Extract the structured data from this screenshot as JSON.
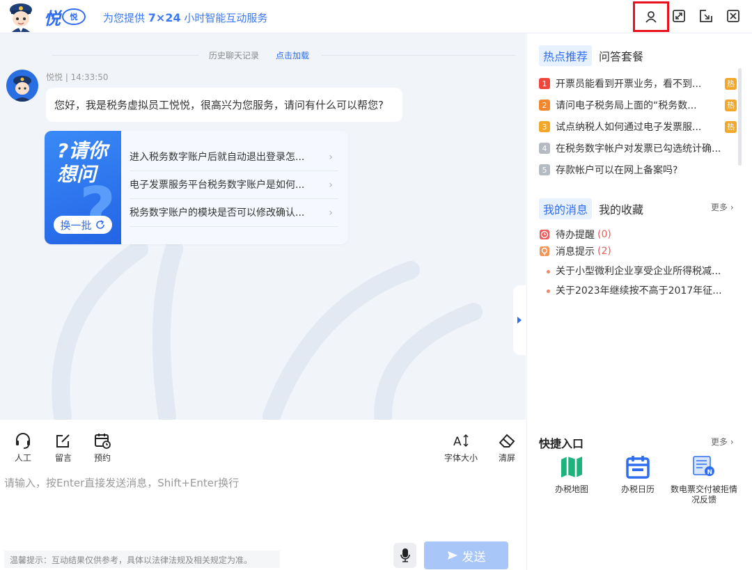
{
  "header": {
    "brand_char": "悦",
    "brand_badge": "悦",
    "slogan_prefix": "为您提供",
    "slogan_hours": "7×24",
    "slogan_suffix": "小时智能互动服务"
  },
  "chat": {
    "history_label": "历史聊天记录",
    "history_link": "点击加载",
    "sender": "悦悦 | 14:33:50",
    "greeting": "您好，我是税务虚拟员工悦悦，很高兴为您服务，请问有什么可以帮您?",
    "suggest_title": "?请你想问",
    "suggest_refresh": "换一批",
    "suggestions": [
      "进入税务数字账户后就自动退出登录怎...",
      "电子发票服务平台税务数字账户是如何...",
      "税务数字账户的模块是否可以修改确认..."
    ]
  },
  "toolbar": {
    "human": "人工",
    "message": "留言",
    "appointment": "预约",
    "font_size": "字体大小",
    "clear": "清屏"
  },
  "input": {
    "placeholder": "请输入，按Enter直接发送消息，Shift+Enter换行",
    "tip": "温馨提示：互动结果仅供参考，具体以法律法规及相关规定为准。",
    "send": "发送"
  },
  "right": {
    "tabs1": [
      "热点推荐",
      "问答套餐"
    ],
    "hot": [
      {
        "n": "1",
        "text": "开票员能看到开票业务，看不到...",
        "tag": "热",
        "color": "#f0463c"
      },
      {
        "n": "2",
        "text": "请问电子税务局上面的“税务数...",
        "tag": "热",
        "color": "#f2872e"
      },
      {
        "n": "3",
        "text": "试点纳税人如何通过电子发票服...",
        "tag": "热",
        "color": "#f3a728"
      },
      {
        "n": "4",
        "text": "在税务数字帐户对发票已勾选统计确...",
        "tag": "",
        "color": "#b6bac2"
      },
      {
        "n": "5",
        "text": "存款帐户可以在网上备案吗?",
        "tag": "",
        "color": "#b6bac2"
      }
    ],
    "tabs2": [
      "我的消息",
      "我的收藏"
    ],
    "more": "更多",
    "todo_label": "待办提醒",
    "todo_count": "(0)",
    "notice_label": "消息提示",
    "notice_count": "(2)",
    "announcements": [
      "关于小型微利企业享受企业所得税减...",
      "关于2023年继续按不高于2017年征..."
    ],
    "quick_title": "快捷入口",
    "quick_more": "更多",
    "quick": [
      "办税地图",
      "办税日历",
      "数电票交付被拒情况反馈"
    ]
  }
}
